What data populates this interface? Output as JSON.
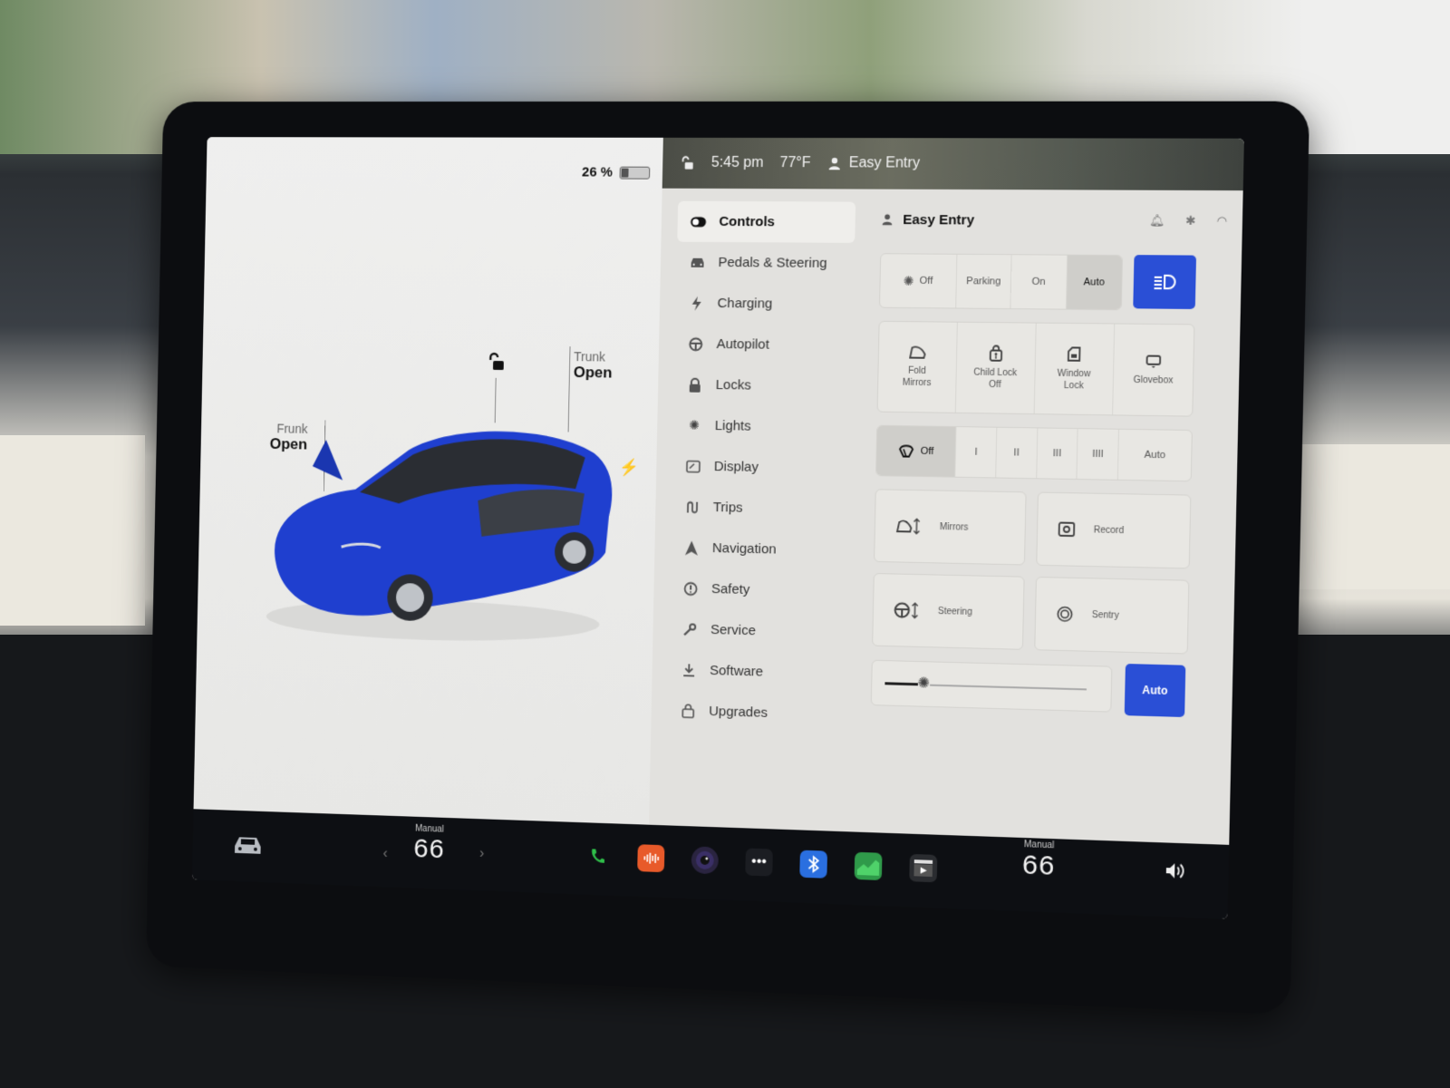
{
  "car_panel": {
    "battery_percent_label": "26 %",
    "battery_level": 0.26,
    "frunk": {
      "label": "Frunk",
      "state": "Open"
    },
    "trunk": {
      "label": "Trunk",
      "state": "Open"
    },
    "lock_state_icon": "unlocked-icon",
    "car_color": "#1f3fcf"
  },
  "status_bar": {
    "lock_icon": "unlocked-icon",
    "time": "5:45 pm",
    "temperature": "77°F",
    "profile_icon": "person-icon",
    "profile_name": "Easy Entry"
  },
  "sidebar": {
    "items": [
      {
        "label": "Controls",
        "icon": "toggle-icon",
        "active": true
      },
      {
        "label": "Pedals & Steering",
        "icon": "car-front-icon"
      },
      {
        "label": "Charging",
        "icon": "bolt-icon"
      },
      {
        "label": "Autopilot",
        "icon": "steering-wheel-icon"
      },
      {
        "label": "Locks",
        "icon": "lock-icon"
      },
      {
        "label": "Lights",
        "icon": "sun-icon"
      },
      {
        "label": "Display",
        "icon": "display-icon"
      },
      {
        "label": "Trips",
        "icon": "trips-icon"
      },
      {
        "label": "Navigation",
        "icon": "navigation-arrow-icon"
      },
      {
        "label": "Safety",
        "icon": "alert-circle-icon"
      },
      {
        "label": "Service",
        "icon": "wrench-icon"
      },
      {
        "label": "Software",
        "icon": "download-icon"
      },
      {
        "label": "Upgrades",
        "icon": "shopping-bag-icon"
      }
    ]
  },
  "controls": {
    "profile_name": "Easy Entry",
    "header_icons": [
      "bell-icon",
      "bluetooth-icon",
      "wifi-icon"
    ],
    "lights": {
      "options": [
        "Off",
        "Parking",
        "On",
        "Auto"
      ],
      "selected": "Auto",
      "headlight_button_icon": "headlight-icon"
    },
    "quick_tiles": [
      {
        "label": "Fold Mirrors",
        "line1": "Fold",
        "line2": "Mirrors",
        "icon": "mirror-icon"
      },
      {
        "label": "Child Lock Off",
        "line1": "Child Lock",
        "line2": "Off",
        "icon": "child-lock-icon"
      },
      {
        "label": "Window Lock",
        "line1": "Window",
        "line2": "Lock",
        "icon": "window-lock-icon"
      },
      {
        "label": "Glovebox",
        "line1": "Glovebox",
        "line2": "",
        "icon": "glovebox-icon"
      }
    ],
    "wipers": {
      "options": [
        "Off",
        "I",
        "II",
        "III",
        "IIII",
        "Auto"
      ],
      "selected": "Off"
    },
    "adjust_cards": [
      {
        "label": "Mirrors",
        "icon": "mirror-adjust-icon"
      },
      {
        "label": "Record",
        "icon": "dashcam-record-icon"
      },
      {
        "label": "Steering",
        "icon": "steering-adjust-icon"
      },
      {
        "label": "Sentry",
        "icon": "sentry-icon"
      }
    ],
    "brightness": {
      "level": 0.2,
      "auto_label": "Auto"
    }
  },
  "taskbar": {
    "car_button_icon": "car-icon",
    "driver_temp": {
      "mode": "Manual",
      "value": "66"
    },
    "passenger_temp": {
      "mode": "Manual",
      "value": "66"
    },
    "apps": [
      {
        "name": "phone",
        "icon": "phone-icon",
        "color": "#2fbf4a"
      },
      {
        "name": "audio",
        "icon": "audio-wave-icon",
        "color": "#e85a2a"
      },
      {
        "name": "camera",
        "icon": "camera-icon",
        "color": "#2a2440"
      },
      {
        "name": "more",
        "icon": "more-dots-icon",
        "color": "#1b1d22"
      },
      {
        "name": "bluetooth",
        "icon": "bluetooth-icon",
        "color": "#2a6fe0"
      },
      {
        "name": "energy",
        "icon": "energy-chart-icon",
        "color": "#2f9a4a"
      },
      {
        "name": "theater",
        "icon": "theater-icon",
        "color": "#2a2c30"
      }
    ],
    "volume_icon": "volume-icon"
  }
}
